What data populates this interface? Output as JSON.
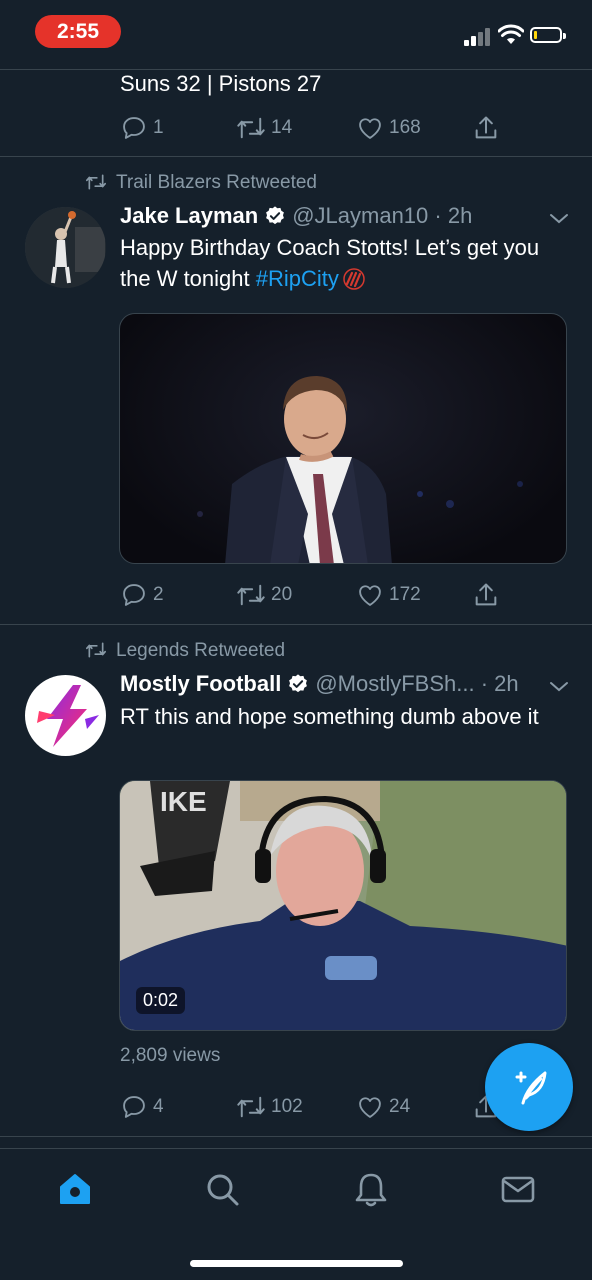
{
  "status_bar": {
    "time": "2:55"
  },
  "tweets": [
    {
      "text": "Suns 32 | Pistons 27",
      "replies": "1",
      "retweets": "14",
      "likes": "168"
    },
    {
      "retweeted_by": "Trail Blazers Retweeted",
      "name": "Jake Layman",
      "handle": "@JLayman10",
      "time": "· 2h",
      "text_plain": "Happy Birthday Coach Stotts! Let’s get you the W tonight ",
      "hashtag": "#RipCity",
      "replies": "2",
      "retweets": "20",
      "likes": "172"
    },
    {
      "retweeted_by": "Legends Retweeted",
      "name": "Mostly Football",
      "handle": "@MostlyFBSh...",
      "time": "· 2h",
      "text_plain": "RT this and hope something dumb above it",
      "video_duration": "0:02",
      "views": "2,809 views",
      "replies": "4",
      "retweets": "102",
      "likes": "24"
    }
  ],
  "colors": {
    "background": "#15202b",
    "accent": "#1da1f2",
    "muted": "#8899a6",
    "divider": "#38444d"
  },
  "tabs": [
    {
      "icon": "home-icon",
      "active": true
    },
    {
      "icon": "search-icon",
      "active": false
    },
    {
      "icon": "bell-icon",
      "active": false
    },
    {
      "icon": "mail-icon",
      "active": false
    }
  ]
}
